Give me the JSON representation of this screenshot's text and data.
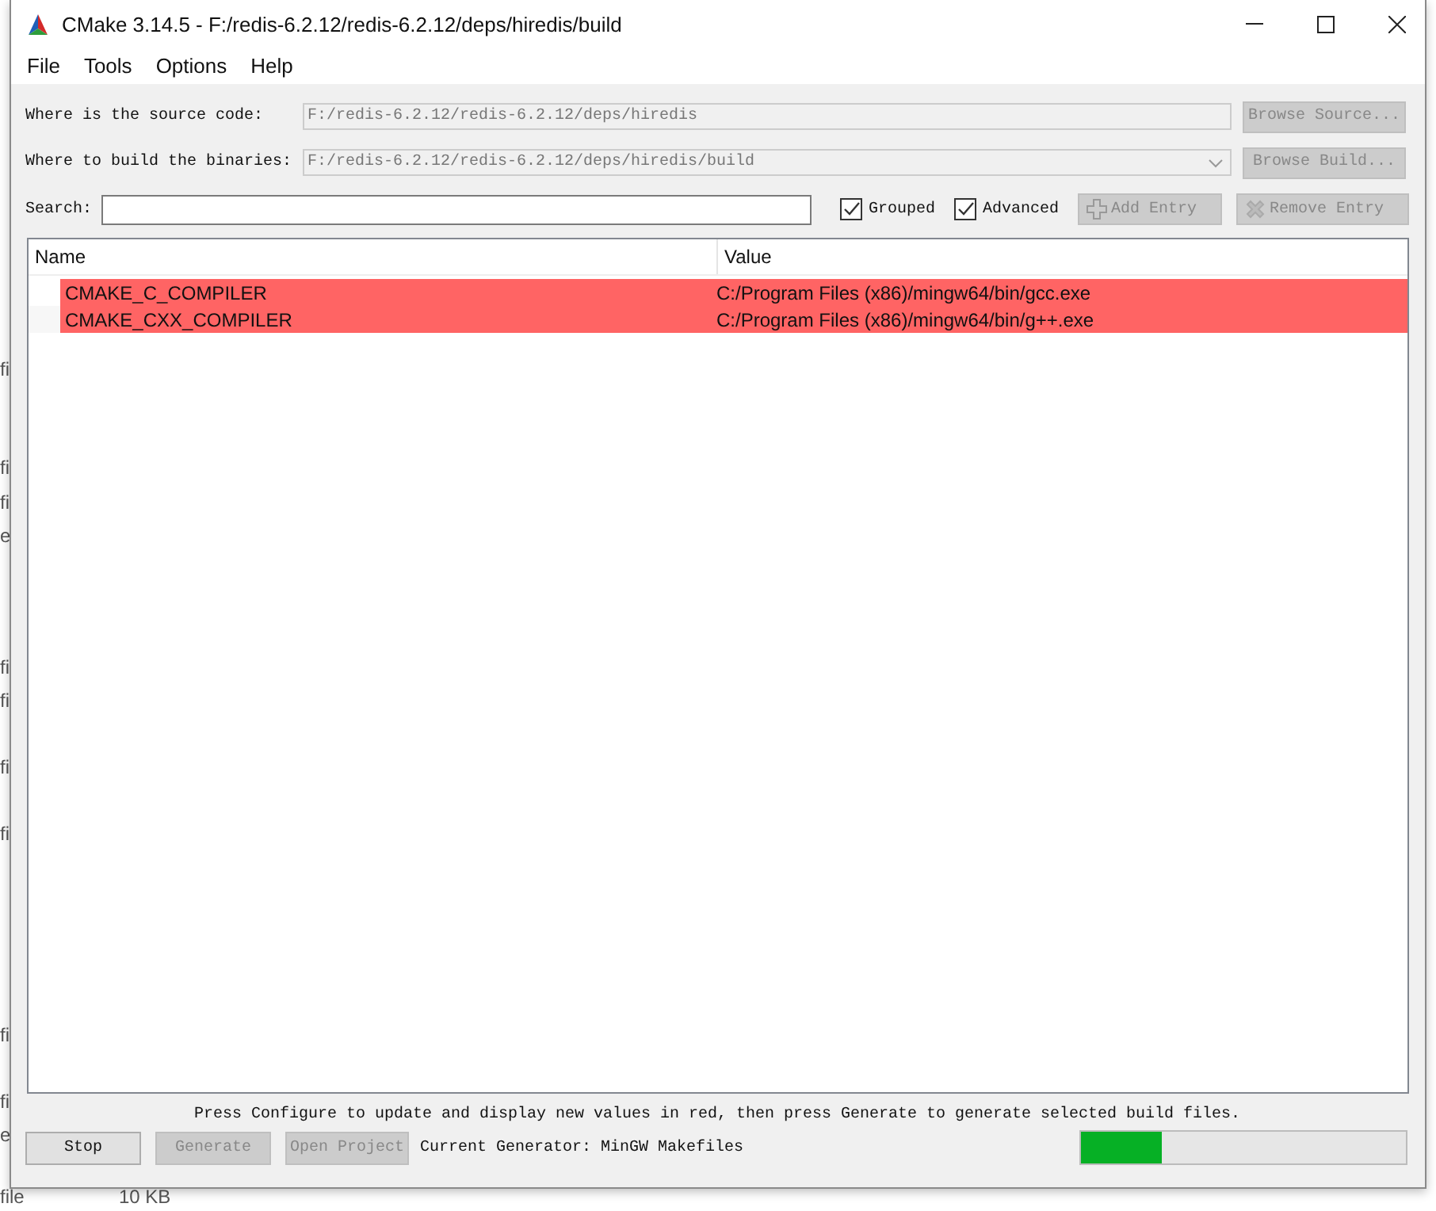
{
  "background_window": {
    "fragments": [
      "fi",
      "fi",
      "fi",
      "e",
      "fi",
      "fi",
      "fi",
      "fi",
      "fi",
      "fi",
      "e"
    ],
    "bottom_row": [
      "file",
      "10 KB"
    ]
  },
  "window": {
    "title": "CMake 3.14.5 - F:/redis-6.2.12/redis-6.2.12/deps/hiredis/build"
  },
  "menu": [
    "File",
    "Tools",
    "Options",
    "Help"
  ],
  "source": {
    "label": "Where is the source code:",
    "value": "F:/redis-6.2.12/redis-6.2.12/deps/hiredis",
    "button": "Browse Source..."
  },
  "build": {
    "label": "Where to build the binaries:",
    "value": "F:/redis-6.2.12/redis-6.2.12/deps/hiredis/build",
    "button": "Browse Build..."
  },
  "search": {
    "label": "Search:"
  },
  "options": [
    {
      "label": "Grouped",
      "checked": true
    },
    {
      "label": "Advanced",
      "checked": true
    }
  ],
  "entry_buttons": [
    {
      "kind": "add",
      "label": "Add Entry",
      "disabled": true
    },
    {
      "kind": "remove",
      "label": "Remove Entry",
      "disabled": true
    }
  ],
  "table": {
    "columns": [
      "Name",
      "Value"
    ],
    "rows": [
      {
        "name": "CMAKE_C_COMPILER",
        "value": "C:/Program Files (x86)/mingw64/bin/gcc.exe",
        "new": true
      },
      {
        "name": "CMAKE_CXX_COMPILER",
        "value": "C:/Program Files (x86)/mingw64/bin/g++.exe",
        "new": true
      }
    ]
  },
  "hint": "Press Configure to update and display new values in red, then press Generate to generate selected build files.",
  "buttons": [
    {
      "label": "Stop",
      "disabled": false
    },
    {
      "label": "Generate",
      "disabled": true
    },
    {
      "label": "Open Project",
      "disabled": true
    }
  ],
  "generator": "Current Generator: MinGW Makefiles",
  "progress": {
    "level": 0.25
  }
}
